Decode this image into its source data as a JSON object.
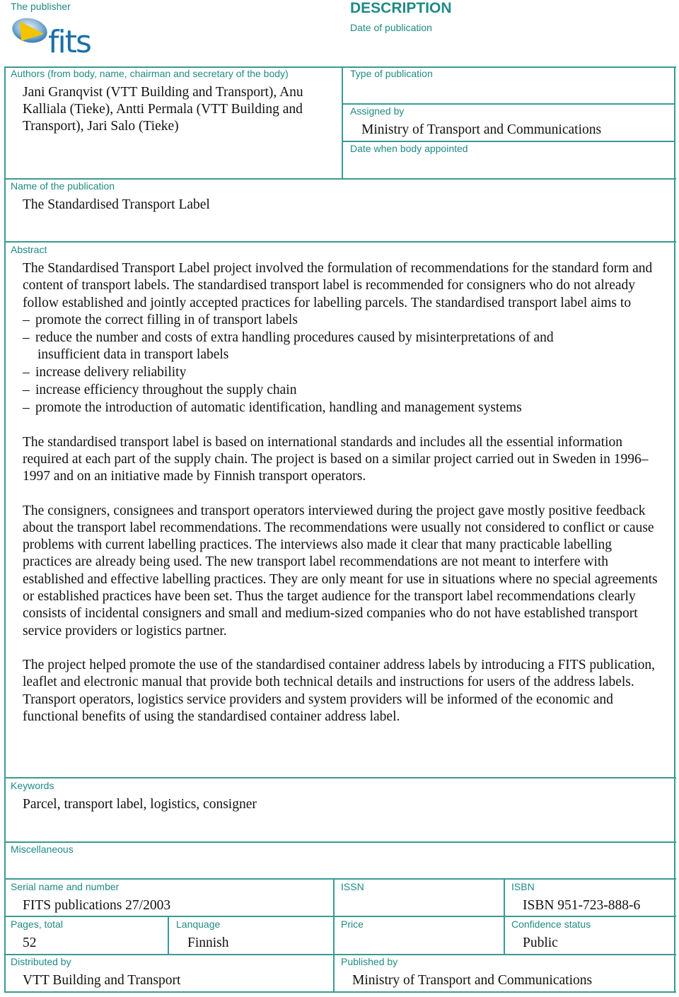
{
  "header": {
    "publisher_label": "The publisher",
    "logo_text": "fits",
    "title": "DESCRIPTION",
    "date_of_publication_label": "Date of publication",
    "date_of_publication_value": ""
  },
  "authors": {
    "label": "Authors (from body, name, chairman and secretary of the body)",
    "value": "Jani Granqvist (VTT Building and Transport), Anu Kalliala (Tieke), Antti Permala (VTT Building and Transport), Jari Salo (Tieke)"
  },
  "type_of_publication": {
    "label": "Type of publication",
    "value": ""
  },
  "assigned_by": {
    "label": "Assigned by",
    "value": "Ministry of Transport and Communications"
  },
  "date_body_appointed": {
    "label": "Date when body appointed",
    "value": ""
  },
  "publication_name": {
    "label": "Name of the publication",
    "value": "The Standardised Transport Label"
  },
  "abstract": {
    "label": "Abstract",
    "intro": "The Standardised Transport Label project involved the formulation of recommendations for the standard form and content of transport labels. The standardised transport label is recommended for consigners who do not already follow established and jointly accepted practices for labelling parcels. The standardised transport label aims to",
    "bullet_dash": "–",
    "bullets": [
      "promote the correct filling in of transport labels",
      "reduce the number and costs of extra handling procedures caused by misinterpretations of and",
      "increase delivery reliability",
      "increase efficiency throughout the supply chain",
      "promote the introduction of automatic identification, handling and management systems"
    ],
    "bullet_2_continuation": "insufficient data in transport labels",
    "paragraphs": [
      "The standardised transport label is based on international standards and includes all the essential information required at each part of the supply chain. The project is based on a similar project carried out in Sweden in 1996–1997 and on an initiative made by Finnish transport operators.",
      "The consigners, consignees and transport operators interviewed during the project gave mostly positive feedback about the transport label recommendations. The recommendations were usually not considered to conflict or cause problems with current labelling practices. The interviews also made it clear that many practicable labelling practices are already being used. The new transport label recommendations are not meant to interfere with established and effective labelling practices. They are only meant for use in situations where no special agreements or established practices have been set. Thus the target audience for the transport label recommendations clearly consists of incidental consigners and small and medium-sized companies who do not have established transport service providers or logistics partner.",
      "The project helped promote the use of the standardised container address labels by introducing a FITS publication, leaflet and electronic manual that provide both technical details and instructions for users of the address labels. Transport operators, logistics service providers and system providers will be informed of the economic and functional benefits of using the standardised container address label."
    ]
  },
  "keywords": {
    "label": "Keywords",
    "value": "Parcel, transport label, logistics, consigner"
  },
  "miscellaneous": {
    "label": "Miscellaneous",
    "value": ""
  },
  "serial": {
    "label": "Serial name and number",
    "value": "FITS publications 27/2003"
  },
  "issn": {
    "label": "ISSN",
    "value": ""
  },
  "isbn": {
    "label": "ISBN",
    "value": "ISBN 951-723-888-6"
  },
  "pages": {
    "label": "Pages, total",
    "value": "52"
  },
  "language": {
    "label": "Lanquage",
    "value": "Finnish"
  },
  "price": {
    "label": "Price",
    "value": ""
  },
  "confidence": {
    "label": "Confidence status",
    "value": "Public"
  },
  "distributed_by": {
    "label": "Distributed by",
    "value": "VTT Building and Transport"
  },
  "published_by": {
    "label": "Published by",
    "value": "Ministry of Transport and Communications"
  },
  "colors": {
    "accent": "#1f8a84",
    "border": "#3a9a93",
    "logo_blue": "#1a6fa8",
    "logo_yellow": "#f2c400"
  }
}
